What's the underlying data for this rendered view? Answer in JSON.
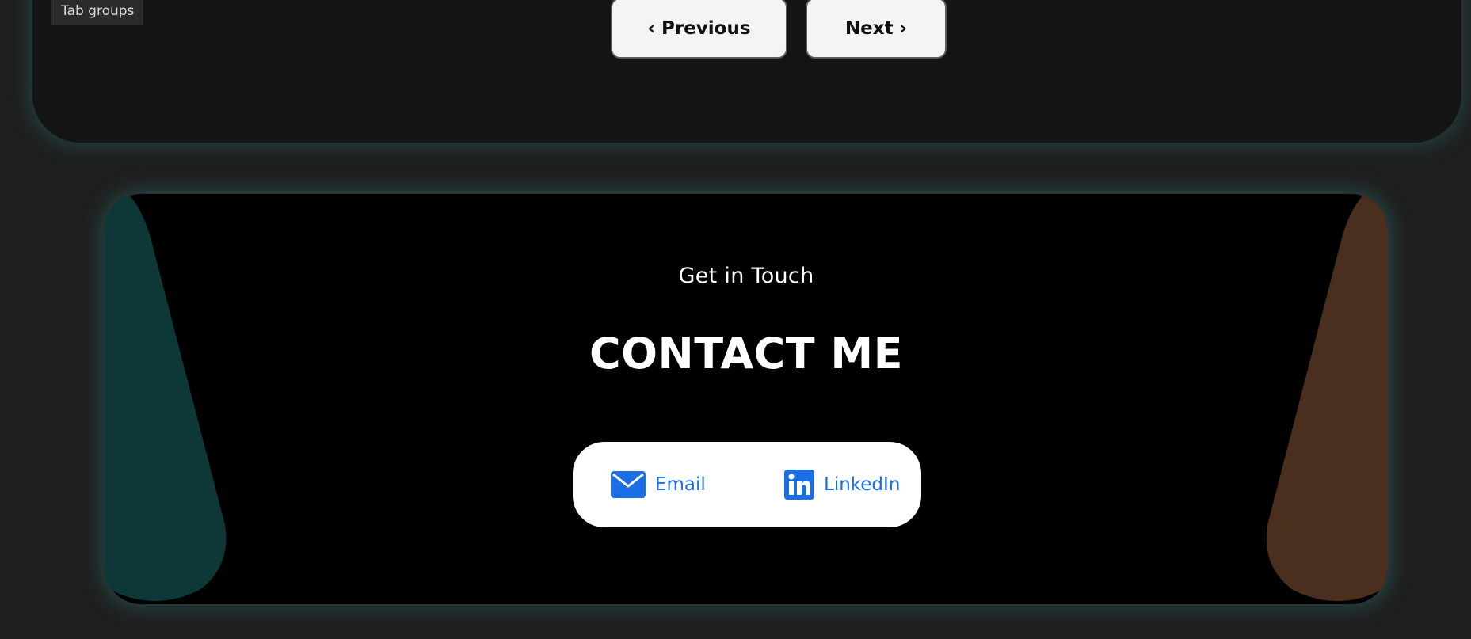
{
  "browser": {
    "tab_groups_label": "Tab groups"
  },
  "pagination": {
    "previous_label": "‹ Previous",
    "next_label": "Next ›"
  },
  "contact": {
    "subtitle": "Get in Touch",
    "title": "CONTACT ME",
    "links": {
      "email_label": "Email",
      "email_icon": "envelope-icon",
      "linkedin_label": "LinkedIn",
      "linkedin_icon": "linkedin-icon"
    }
  },
  "colors": {
    "page_background": "#1f1f1f",
    "panel_background": "#141414",
    "card_background": "#000000",
    "glow": "#2c6868",
    "left_shape": "#0e3838",
    "right_shape": "#4a2f1f",
    "link_blue": "#1a6ee6"
  }
}
